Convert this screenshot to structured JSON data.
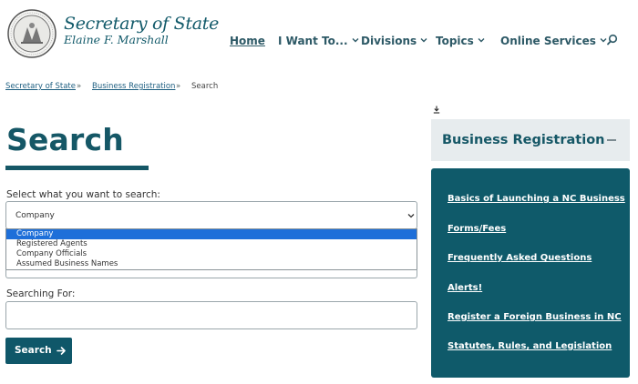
{
  "header": {
    "title": "Secretary of State",
    "subtitle": "Elaine F. Marshall",
    "nav": [
      "Home",
      "I Want To...",
      "Divisions",
      "Topics",
      "Online Services"
    ]
  },
  "breadcrumb": {
    "items": [
      "Secretary of State",
      "Business Registration",
      "Search"
    ],
    "separator": "»"
  },
  "page": {
    "title": "Search"
  },
  "form": {
    "select_label": "Select what you want to search:",
    "select_value": "Company",
    "options": [
      "Company",
      "Registered Agents",
      "Company Officials",
      "Assumed Business Names"
    ],
    "search_label": "Searching For:",
    "search_value": "",
    "button_label": "Search"
  },
  "sidebar": {
    "title": "Business Registration",
    "links": [
      "Basics of Launching a NC Business",
      "Forms/Fees",
      "Frequently Asked Questions",
      "Alerts!",
      "Register a Foreign Business in NC",
      "Statutes, Rules, and Legislation"
    ]
  },
  "colors": {
    "brand": "#155766",
    "panel": "#0f5a6a",
    "selection": "#1e6fd9",
    "link": "#1d5e80"
  },
  "icons": [
    "state-seal-icon",
    "chevron-down-icon",
    "search-icon",
    "download-icon",
    "collapse-icon",
    "arrow-right-icon"
  ]
}
